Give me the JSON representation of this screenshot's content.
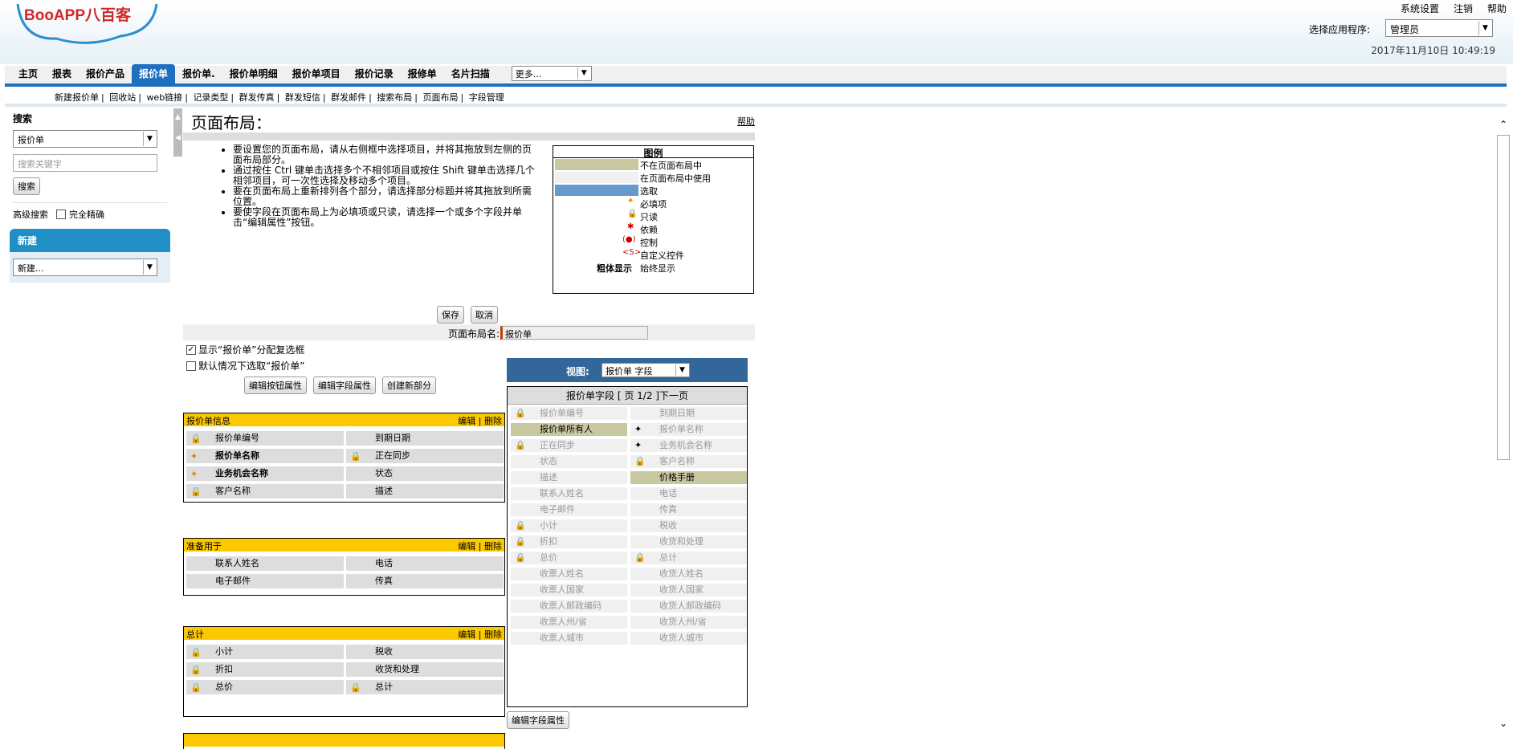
{
  "header": {
    "logo_text": "BooAPP八百客",
    "links": [
      "系统设置",
      "注销",
      "帮助"
    ],
    "app_label": "选择应用程序:",
    "app_select": "管理员",
    "datetime": "2017年11月10日 10:49:19"
  },
  "tabs": [
    "主页",
    "报表",
    "报价产品",
    "报价单",
    "报价单.",
    "报价单明细",
    "报价单项目",
    "报价记录",
    "报修单",
    "名片扫描"
  ],
  "active_tab": "报价单",
  "more_select": "更多...",
  "subnav": [
    "新建报价单",
    "回收站",
    "web链接",
    "记录类型",
    "群发传真",
    "群发短信",
    "群发邮件",
    "搜索布局",
    "页面布局",
    "字段管理"
  ],
  "sidebar": {
    "search_title": "搜索",
    "search_select": "报价单",
    "search_placeholder": "搜索关键字",
    "search_button": "搜索",
    "advanced": "高级搜索",
    "exact": "完全精确",
    "new_title": "新建",
    "new_select": "新建..."
  },
  "main": {
    "title": "页面布局：",
    "help": "帮助",
    "instructions": [
      "要设置您的页面布局，请从右侧框中选择项目，并将其拖放到左侧的页面布局部分。",
      "通过按住 Ctrl 键单击选择多个不相邻项目或按住 Shift 键单击选择几个相邻项目，可一次性选择及移动多个项目。",
      "要在页面布局上重新排列各个部分，请选择部分标题并将其拖放到所需位置。",
      "要使字段在页面布局上为必填项或只读，请选择一个或多个字段并单击“编辑属性”按钮。"
    ],
    "legend_title": "图例",
    "legend": [
      "不在页面布局中",
      "在页面布局中使用",
      "选取",
      "必填项",
      "只读",
      "依赖",
      "控制",
      "自定义控件",
      "始终显示"
    ],
    "legend_bold_label": "粗体显示",
    "save": "保存",
    "cancel": "取消",
    "layout_name_label": "页面布局名:",
    "layout_name_value": "报价单",
    "checkbox1": "显示“报价单”分配复选框",
    "checkbox2": "默认情况下选取“报价单”",
    "btn_edit_buttons": "编辑按钮属性",
    "btn_edit_fields": "编辑字段属性",
    "btn_new_section": "创建新部分",
    "section_actions": "编辑 | 删除"
  },
  "sections": [
    {
      "title": "报价单信息",
      "fields": [
        {
          "label": "报价单编号",
          "icon": "lock"
        },
        {
          "label": "到期日期",
          "icon": ""
        },
        {
          "label": "报价单名称",
          "icon": "req",
          "bold": true
        },
        {
          "label": "正在同步",
          "icon": "lock"
        },
        {
          "label": "业务机会名称",
          "icon": "req",
          "bold": true
        },
        {
          "label": "状态",
          "icon": ""
        },
        {
          "label": "客户名称",
          "icon": "lock"
        },
        {
          "label": "描述",
          "icon": ""
        }
      ]
    },
    {
      "title": "准备用于",
      "fields": [
        {
          "label": "联系人姓名",
          "icon": ""
        },
        {
          "label": "电话",
          "icon": ""
        },
        {
          "label": "电子邮件",
          "icon": ""
        },
        {
          "label": "传真",
          "icon": ""
        }
      ]
    },
    {
      "title": "总计",
      "fields": [
        {
          "label": "小计",
          "icon": "lock"
        },
        {
          "label": "税收",
          "icon": ""
        },
        {
          "label": "折扣",
          "icon": "lock"
        },
        {
          "label": "收货和处理",
          "icon": ""
        },
        {
          "label": "总价",
          "icon": "lock"
        },
        {
          "label": "总计",
          "icon": "lock"
        }
      ]
    }
  ],
  "palette": {
    "view_label": "视图:",
    "view_select": "报价单 字段",
    "title": "报价单字段 [ 页 1/2 ]下一页",
    "fields": [
      {
        "label": "报价单编号",
        "icon": "lock"
      },
      {
        "label": "到期日期",
        "icon": ""
      },
      {
        "label": "报价单所有人",
        "icon": "",
        "used": true
      },
      {
        "label": "报价单名称",
        "icon": "req"
      },
      {
        "label": "正在同步",
        "icon": "lock"
      },
      {
        "label": "业务机会名称",
        "icon": "req"
      },
      {
        "label": "状态",
        "icon": ""
      },
      {
        "label": "客户名称",
        "icon": "lock"
      },
      {
        "label": "描述",
        "icon": ""
      },
      {
        "label": "价格手册",
        "icon": "",
        "used": true
      },
      {
        "label": "联系人姓名",
        "icon": ""
      },
      {
        "label": "电话",
        "icon": ""
      },
      {
        "label": "电子邮件",
        "icon": ""
      },
      {
        "label": "传真",
        "icon": ""
      },
      {
        "label": "小计",
        "icon": "lock"
      },
      {
        "label": "税收",
        "icon": ""
      },
      {
        "label": "折扣",
        "icon": "lock"
      },
      {
        "label": "收货和处理",
        "icon": ""
      },
      {
        "label": "总价",
        "icon": "lock"
      },
      {
        "label": "总计",
        "icon": "lock"
      },
      {
        "label": "收票人姓名",
        "icon": ""
      },
      {
        "label": "收货人姓名",
        "icon": ""
      },
      {
        "label": "收票人国家",
        "icon": ""
      },
      {
        "label": "收货人国家",
        "icon": ""
      },
      {
        "label": "收票人邮政编码",
        "icon": ""
      },
      {
        "label": "收货人邮政编码",
        "icon": ""
      },
      {
        "label": "收票人州/省",
        "icon": ""
      },
      {
        "label": "收货人州/省",
        "icon": ""
      },
      {
        "label": "收票人城市",
        "icon": ""
      },
      {
        "label": "收货人城市",
        "icon": ""
      }
    ],
    "edit_button": "编辑字段属性"
  }
}
